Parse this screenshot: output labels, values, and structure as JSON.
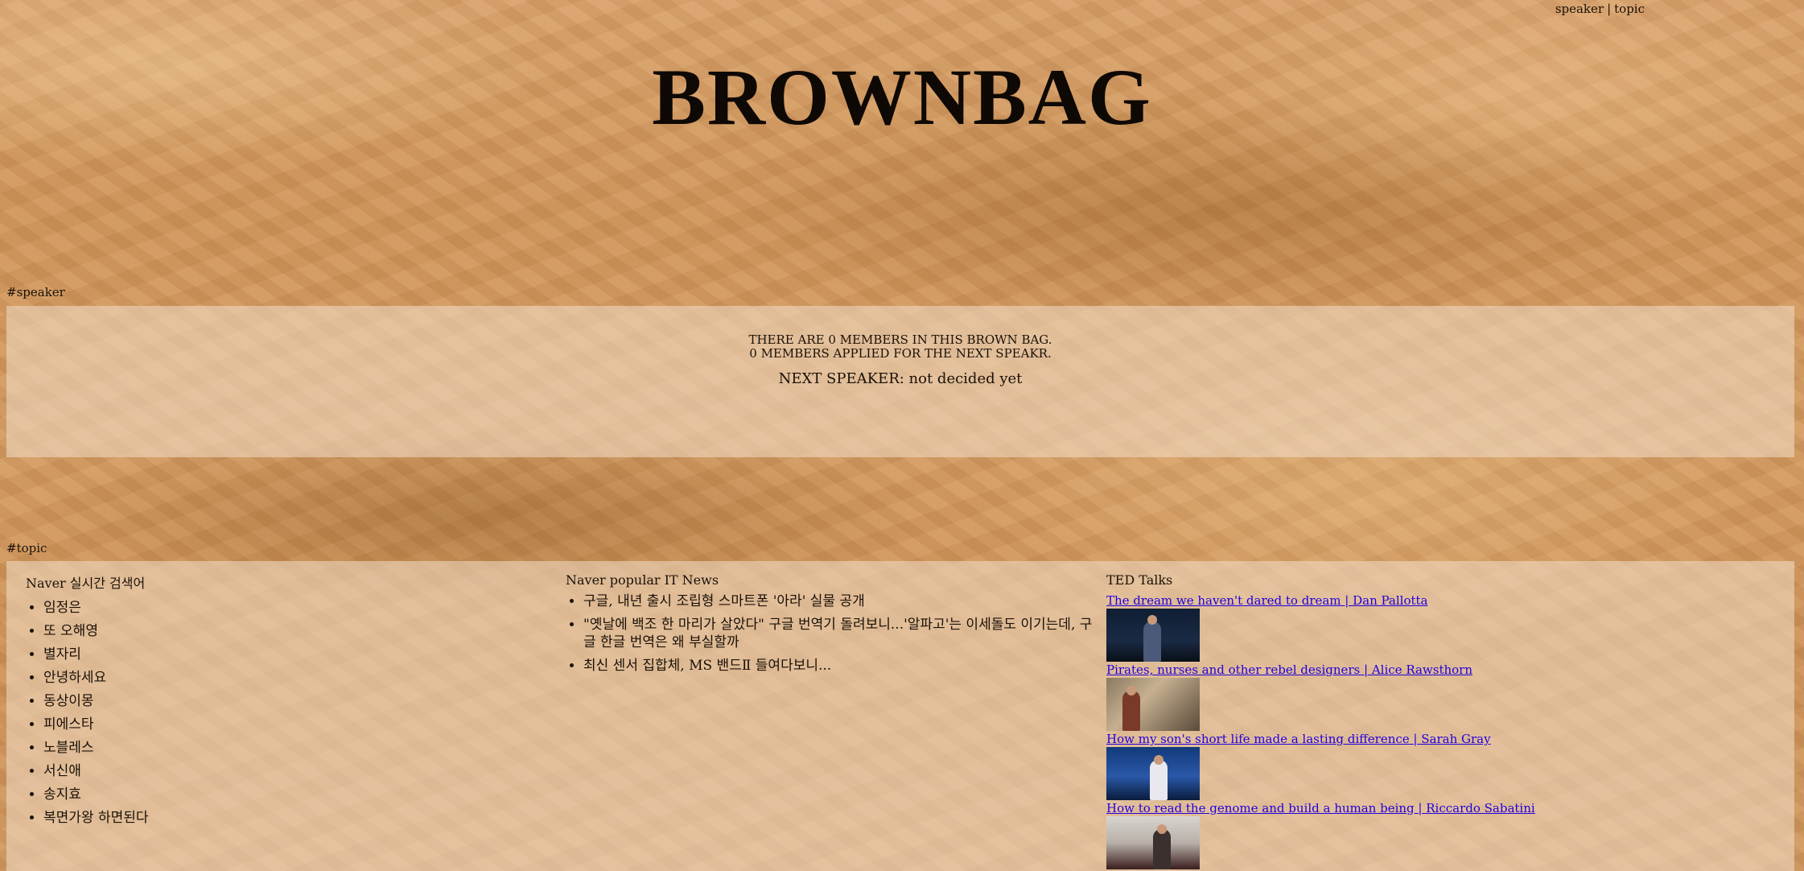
{
  "nav": {
    "speaker": "speaker",
    "separator": "|",
    "topic": "topic"
  },
  "brand": {
    "title": "BROWNBAG"
  },
  "speaker_section": {
    "label": "#speaker",
    "members_line": "There are 0 members in this brown bag.",
    "applied_line": "0 members applied for the next speakr.",
    "next_speaker": "NEXT SPEAKER: not decided yet"
  },
  "topic_section": {
    "label": "#topic",
    "naver_search": {
      "heading": "Naver 실시간 검색어",
      "items": [
        "임정은",
        "또 오해영",
        "별자리",
        "안녕하세요",
        "동상이몽",
        "피에스타",
        "노블레스",
        "서신애",
        "송지효",
        "복면가왕 하면된다"
      ]
    },
    "it_news": {
      "heading": "Naver popular IT News",
      "items": [
        "구글, 내년 출시 조립형 스마트폰 '아라' 실물 공개",
        "\"옛날에 백조 한 마리가 살았다\" 구글 번역기 돌려보니...'알파고'는 이세돌도 이기는데, 구글 한글 번역은 왜 부실할까",
        "최신 센서 집합체, MS 밴드Ⅱ 들여다보니..."
      ]
    },
    "ted": {
      "heading": "TED Talks",
      "items": [
        {
          "title": "The dream we haven't dared to dream | Dan Pallotta"
        },
        {
          "title": "Pirates, nurses and other rebel designers | Alice Rawsthorn"
        },
        {
          "title": "How my son's short life made a lasting difference | Sarah Gray"
        },
        {
          "title": "How to read the genome and build a human being | Riccardo Sabatini"
        }
      ]
    }
  }
}
